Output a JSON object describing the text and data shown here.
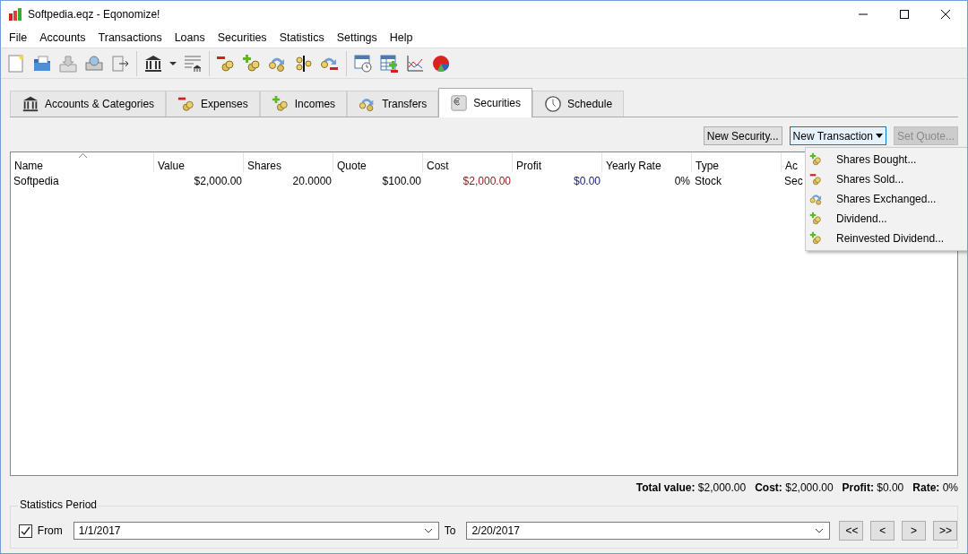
{
  "window": {
    "title": "Softpedia.eqz - Eqonomize!"
  },
  "menu_bar": [
    "File",
    "Accounts",
    "Transactions",
    "Loans",
    "Securities",
    "Statistics",
    "Settings",
    "Help"
  ],
  "tabs": [
    {
      "label": "Accounts & Categories",
      "kind": "bank",
      "selected": false
    },
    {
      "label": "Expenses",
      "kind": "minus",
      "selected": false
    },
    {
      "label": "Incomes",
      "kind": "plus",
      "selected": false
    },
    {
      "label": "Transfers",
      "kind": "transfer",
      "selected": false
    },
    {
      "label": "Securities",
      "kind": "euro",
      "selected": true
    },
    {
      "label": "Schedule",
      "kind": "clock",
      "selected": false
    }
  ],
  "actions": [
    {
      "label": "New Security...",
      "disabled": false,
      "kind": "plain"
    },
    {
      "label": "New Transaction",
      "disabled": false,
      "kind": "dropdown"
    },
    {
      "label": "Set Quote...",
      "disabled": true,
      "kind": "plain"
    }
  ],
  "table": {
    "columns": [
      "Name",
      "Value",
      "Shares",
      "Quote",
      "Cost",
      "Profit",
      "Yearly Rate",
      "Type",
      "Ac"
    ],
    "rows": [
      {
        "cells": [
          {
            "text": "Softpedia"
          },
          {
            "text": "$2,000.00"
          },
          {
            "text": "20.0000"
          },
          {
            "text": "$100.00"
          },
          {
            "text": "$2,000.00",
            "color": "#8b1a1a"
          },
          {
            "text": "$0.00",
            "color": "#1a237e"
          },
          {
            "text": "0%"
          },
          {
            "text": "Stock"
          },
          {
            "text": "Sec"
          }
        ]
      }
    ]
  },
  "dropdown_menu": [
    {
      "label": "Shares Bought...",
      "kind": "plus"
    },
    {
      "label": "Shares Sold...",
      "kind": "minus"
    },
    {
      "label": "Shares Exchanged...",
      "kind": "transfer"
    },
    {
      "label": "Dividend...",
      "kind": "plus"
    },
    {
      "label": "Reinvested Dividend...",
      "kind": "plus"
    }
  ],
  "summary": [
    "**Total value:** $2,000.00",
    "**Cost:** $2,000.00",
    "**Profit:** $0.00",
    "**Rate:** 0%"
  ],
  "statistics_period": {
    "title": "Statistics Period",
    "from_checked": true,
    "from_label": "From",
    "from": "1/1/2017",
    "to_label": "To",
    "to": "2/20/2017",
    "nav": [
      "<<",
      "<",
      ">",
      ">>"
    ]
  }
}
